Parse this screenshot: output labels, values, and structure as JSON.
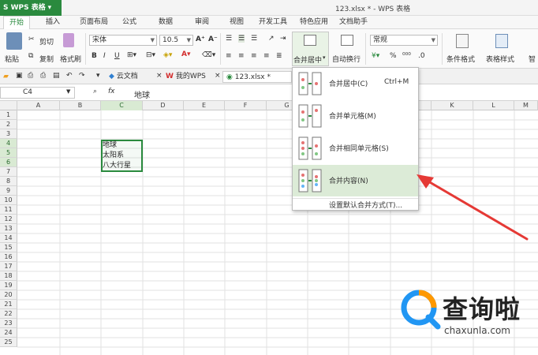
{
  "titlebar": {
    "app_name": "WPS 表格",
    "file_title": "123.xlsx * - WPS 表格"
  },
  "menu": [
    "开始",
    "插入",
    "页面布局",
    "公式",
    "数据",
    "审阅",
    "视图",
    "开发工具",
    "特色应用",
    "文档助手"
  ],
  "menu_active": "开始",
  "ribbon": {
    "cut": "剪切",
    "paste": "粘贴",
    "copy": "复制",
    "format_painter": "格式刷",
    "font_name": "宋体",
    "font_size": "10.5",
    "merge_center": "合并居中",
    "wrap_text": "自动换行",
    "number_format": "常规",
    "conditional_format": "条件格式",
    "table_style": "表格样式",
    "more": "智"
  },
  "doc_tabs": [
    "云文档",
    "我的WPS",
    "123.xlsx *"
  ],
  "formula_bar": {
    "cell_ref": "C4",
    "fx": "fx",
    "value": "地球"
  },
  "columns": [
    "A",
    "B",
    "C",
    "D",
    "E",
    "F",
    "G",
    "H",
    "I",
    "J",
    "K",
    "L",
    "M"
  ],
  "selected_column": "C",
  "rows": [
    "1",
    "2",
    "3",
    "4",
    "5",
    "6",
    "7",
    "8",
    "9",
    "10",
    "11",
    "12",
    "13",
    "14",
    "15",
    "16",
    "17",
    "18",
    "19",
    "20",
    "21",
    "22",
    "23",
    "24",
    "25"
  ],
  "selected_rows": [
    "4",
    "5",
    "6"
  ],
  "cells": {
    "C4": "地球",
    "C5": "太阳系",
    "C6": "八大行星"
  },
  "merge_menu": {
    "items": [
      {
        "label": "合并居中(C)",
        "shortcut": "Ctrl+M"
      },
      {
        "label": "合并单元格(M)",
        "shortcut": ""
      },
      {
        "label": "合并相同单元格(S)",
        "shortcut": ""
      },
      {
        "label": "合并内容(N)",
        "shortcut": ""
      }
    ],
    "highlighted_index": 3,
    "footer": "设置默认合并方式(T)..."
  },
  "watermark": {
    "text": "查询啦",
    "url": "chaxunla.com"
  },
  "colors": {
    "accent": "#2a8a3e",
    "arrow": "#e53935"
  }
}
